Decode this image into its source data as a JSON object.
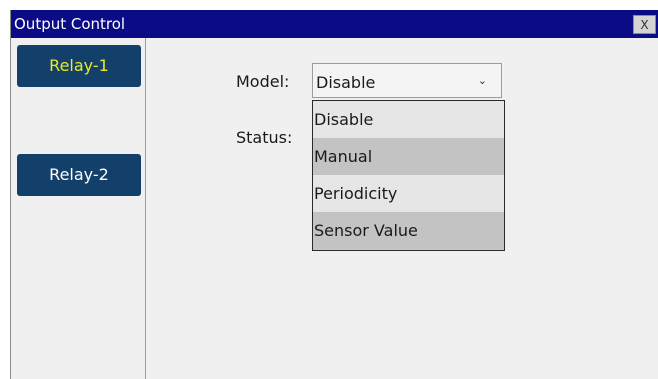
{
  "window": {
    "title": "Output Control",
    "close_label": "X"
  },
  "sidebar": {
    "items": [
      {
        "label": "Relay-1",
        "active": true
      },
      {
        "label": "Relay-2",
        "active": false
      }
    ]
  },
  "form": {
    "model_label": "Model:",
    "status_label": "Status:",
    "model_selected": "Disable",
    "model_options": [
      "Disable",
      "Manual",
      "Periodicity",
      "Sensor Value"
    ]
  },
  "colors": {
    "titlebar": "#0b0b86",
    "button": "#12406b",
    "active_text": "#eaea22"
  }
}
